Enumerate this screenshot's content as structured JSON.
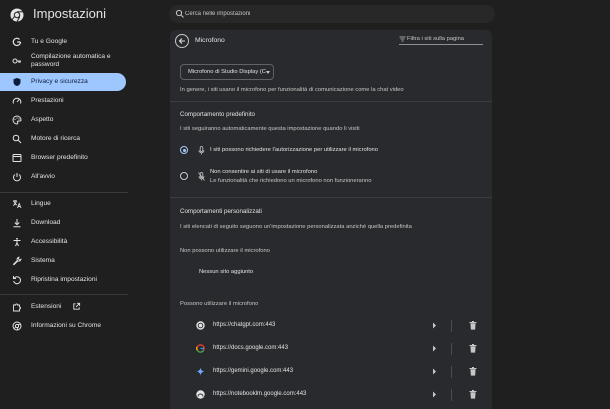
{
  "header": {
    "title": "Impostazioni",
    "search_placeholder": "Cerca nelle impostazioni"
  },
  "sidebar": {
    "items": [
      {
        "label": "Tu e Google",
        "icon": "google-icon"
      },
      {
        "label": "Compilazione automatica e password",
        "icon": "key-icon"
      },
      {
        "label": "Privacy e sicurezza",
        "icon": "shield-icon",
        "active": true
      },
      {
        "label": "Prestazioni",
        "icon": "speedometer-icon"
      },
      {
        "label": "Aspetto",
        "icon": "palette-icon"
      },
      {
        "label": "Motore di ricerca",
        "icon": "search-icon"
      },
      {
        "label": "Browser predefinito",
        "icon": "browser-icon"
      },
      {
        "label": "All'avvio",
        "icon": "power-icon"
      },
      {
        "label": "Lingue",
        "icon": "translate-icon"
      },
      {
        "label": "Download",
        "icon": "download-icon"
      },
      {
        "label": "Accessibilità",
        "icon": "accessibility-icon"
      },
      {
        "label": "Sistema",
        "icon": "wrench-icon"
      },
      {
        "label": "Ripristina impostazioni",
        "icon": "reset-icon"
      },
      {
        "label": "Estensioni",
        "icon": "puzzle-icon"
      },
      {
        "label": "Informazioni su Chrome",
        "icon": "chrome-icon"
      }
    ]
  },
  "main": {
    "title": "Microfono",
    "filter_placeholder": "Filtra i siti sulla pagina",
    "device_select": "Microfono di Studio Display (C",
    "description": "In genere, i siti usano il microfono per funzionalità di comunicazione come la chat video",
    "default_heading": "Comportamento predefinito",
    "default_desc": "I siti seguiranno automaticamente questa impostazione quando li visiti",
    "option_allow": "I siti possono richiedere l'autorizzazione per utilizzare il microfono",
    "option_block": "Non consentire ai siti di usare il microfono",
    "option_block_sub": "Le funzionalità che richiedono un microfono non funzioneranno",
    "custom_heading": "Comportamenti personalizzati",
    "custom_desc": "I siti elencati di seguito seguono un'impostazione personalizzata anziché quella predefinita",
    "blocked_heading": "Non possono utilizzare il microfono",
    "blocked_empty": "Nessun sito aggiunto",
    "allowed_heading": "Possono utilizzare il microfono",
    "allowed_sites": [
      {
        "url": "https://chatgpt.com:443",
        "icon": "chatgpt-favicon"
      },
      {
        "url": "https://docs.google.com:443",
        "icon": "google-favicon"
      },
      {
        "url": "https://gemini.google.com:443",
        "icon": "gemini-favicon"
      },
      {
        "url": "https://notebooklm.google.com:443",
        "icon": "notebooklm-favicon"
      }
    ]
  },
  "colors": {
    "accent": "#9ec6ff",
    "background": "#1f1f1f",
    "panel": "#292a2d"
  }
}
